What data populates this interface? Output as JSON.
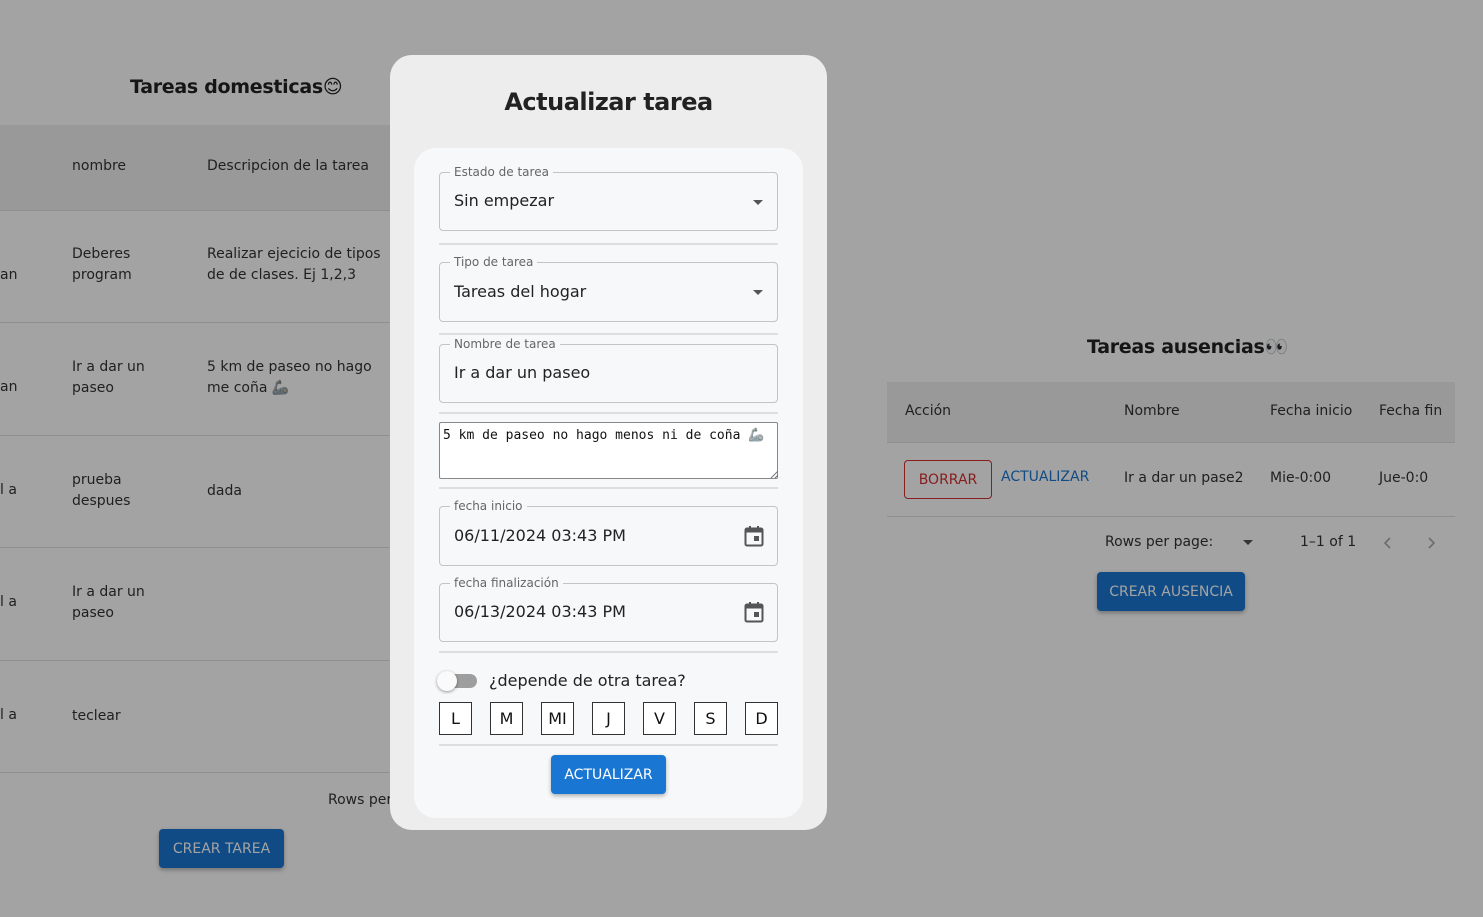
{
  "left_panel": {
    "title": "Tareas domesticas😊",
    "headers": [
      "nombre",
      "Descripcion de la tarea"
    ],
    "rows": [
      {
        "c0": "an",
        "nombre": "Deberes program",
        "descripcion": "Realizar ejecicio de tipos de de clases. Ej 1,2,3"
      },
      {
        "c0": "an",
        "nombre": "Ir a dar un paseo",
        "descripcion": "5 km de paseo no hago me coña 🦾"
      },
      {
        "c0": "l a",
        "nombre": "prueba despues",
        "descripcion": "dada"
      },
      {
        "c0": "l a",
        "nombre": "Ir a dar un paseo",
        "descripcion": ""
      },
      {
        "c0": "l a",
        "nombre": "teclear",
        "descripcion": ""
      }
    ],
    "rows_per_page_label": "Rows per",
    "create_button": "CREAR TAREA"
  },
  "right_panel": {
    "title": "Tareas ausencias👀",
    "headers": [
      "Acción",
      "Nombre",
      "Fecha inicio",
      "Fecha fin"
    ],
    "row": {
      "delete_label": "BORRAR",
      "update_label": "ACTUALIZAR",
      "nombre": "Ir a dar un pase2",
      "fecha_inicio": "Mie-0:00",
      "fecha_fin": "Jue-0:0"
    },
    "pagination": {
      "rows_per_page_label": "Rows per page:",
      "range": "1–1 of 1"
    },
    "create_button": "CREAR AUSENCIA"
  },
  "modal": {
    "title": "Actualizar tarea",
    "estado": {
      "label": "Estado de tarea",
      "value": "Sin empezar"
    },
    "tipo": {
      "label": "Tipo de tarea",
      "value": "Tareas del hogar"
    },
    "nombre": {
      "label": "Nombre de tarea",
      "value": "Ir a dar un paseo"
    },
    "descripcion": "5 km de paseo no hago menos ni de coña 🦾",
    "fecha_inicio": {
      "label": "fecha inicio",
      "value": "06/11/2024 03:43 PM"
    },
    "fecha_fin": {
      "label": "fecha finalización",
      "value": "06/13/2024 03:43 PM"
    },
    "depende_label": "¿depende de otra tarea?",
    "depende_checked": false,
    "days": [
      "L",
      "M",
      "MI",
      "J",
      "V",
      "S",
      "D"
    ],
    "submit_label": "ACTUALIZAR"
  },
  "colors": {
    "primary": "#1976d2",
    "error": "#d32f2f",
    "backdrop": "rgba(0,0,0,0.36)"
  }
}
